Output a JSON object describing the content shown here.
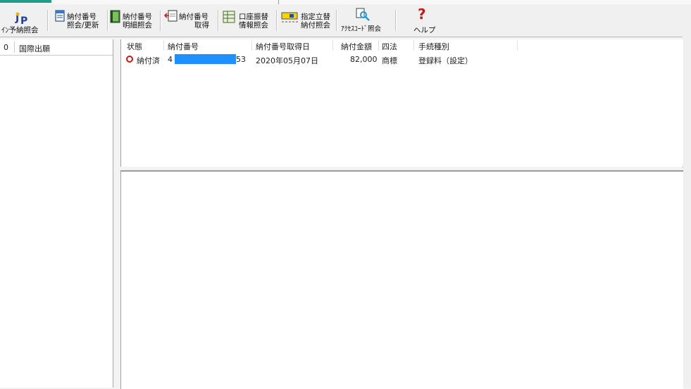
{
  "toolbar": {
    "buttons": [
      {
        "id": "yoyaku",
        "label": "ｲﾝ予納照会",
        "icon": "jp-logo-icon"
      },
      {
        "id": "noufu-shoukai",
        "label1": "納付番号",
        "label2": "照会/更新",
        "icon": "document-search-icon"
      },
      {
        "id": "noufu-meisai",
        "label1": "納付番号",
        "label2": "明細照会",
        "icon": "book-icon"
      },
      {
        "id": "noufu-shutoku",
        "label1": "納付番号",
        "label2": "取得",
        "icon": "document-fetch-icon"
      },
      {
        "id": "kouza",
        "label1": "口座振替",
        "label2": "情報照会",
        "icon": "table-icon"
      },
      {
        "id": "shitei",
        "label1": "指定立替",
        "label2": "納付照会",
        "icon": "card-icon"
      },
      {
        "id": "access",
        "label": "ｱｸｾｽｺｰﾄﾞ照会",
        "icon": "key-search-icon"
      },
      {
        "id": "help",
        "label": "ヘルプ",
        "icon": "question-icon"
      }
    ]
  },
  "left_pane": {
    "headers": [
      "0",
      "国際出願"
    ]
  },
  "list": {
    "columns": [
      "状態",
      "納付番号",
      "納付番号取得日",
      "納付金額",
      "四法",
      "手続種別"
    ],
    "rows": [
      {
        "status": "納付済",
        "number_prefix": "4",
        "number_suffix": "53",
        "date": "2020年05月07日",
        "amount": "82,000",
        "law": "商標",
        "procedure": "登録料（設定）"
      }
    ]
  },
  "colors": {
    "accent": "#1e9e8a",
    "redaction": "#1e90ff",
    "status_ring": "#d01414"
  }
}
